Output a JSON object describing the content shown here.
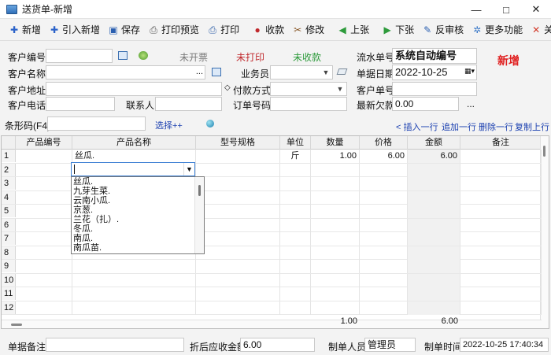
{
  "window": {
    "title": "送货单-新增",
    "minimize": "—",
    "maximize": "□",
    "close": "✕"
  },
  "toolbar": [
    {
      "id": "new",
      "label": "新增",
      "icon": "plus-icon",
      "glyph": "✚",
      "color": "#2c63c9"
    },
    {
      "id": "import-new",
      "label": "引入新增",
      "icon": "plus-icon",
      "glyph": "✚",
      "color": "#2c63c9"
    },
    {
      "id": "save",
      "label": "保存",
      "icon": "save-icon",
      "glyph": "▣",
      "color": "#2a5fb0"
    },
    {
      "id": "print-preview",
      "label": "打印预览",
      "icon": "print-preview-icon",
      "glyph": "⎙",
      "color": "#555"
    },
    {
      "id": "print",
      "label": "打印",
      "icon": "printer-icon",
      "glyph": "⎙",
      "color": "#2f5fa8"
    },
    {
      "id": "collect",
      "label": "收款",
      "icon": "collect-icon",
      "glyph": "●",
      "color": "#c0282c"
    },
    {
      "id": "edit",
      "label": "修改",
      "icon": "edit-icon",
      "glyph": "✂",
      "color": "#8a5a2b"
    },
    {
      "id": "prev",
      "label": "上张",
      "icon": "prev-icon",
      "glyph": "◀",
      "color": "#2e9b3c"
    },
    {
      "id": "next",
      "label": "下张",
      "icon": "next-icon",
      "glyph": "▶",
      "color": "#2e9b3c"
    },
    {
      "id": "unaudit",
      "label": "反审核",
      "icon": "unaudit-icon",
      "glyph": "✎",
      "color": "#2a5fb0"
    },
    {
      "id": "more",
      "label": "更多功能",
      "icon": "gear-icon",
      "glyph": "✲",
      "color": "#3a78c8"
    },
    {
      "id": "close",
      "label": "关闭",
      "icon": "close-icon",
      "glyph": "✕",
      "color": "#d23a2a"
    }
  ],
  "form": {
    "customer_code_label": "客户编号",
    "customer_name_label": "客户名称",
    "customer_address_label": "客户地址",
    "customer_phone_label": "客户电话",
    "contact_label": "联系人",
    "status_invoice": "未开票",
    "status_print": "未打印",
    "status_collect": "未收款",
    "salesman_label": "业务员",
    "payment_label": "付款方式",
    "order_no_label": "订单号码",
    "serial_label": "流水单号",
    "serial_value": "系统自动编号",
    "doc_date_label": "单据日期",
    "doc_date_value": "2022-10-25",
    "customer_doc_label": "客户单号",
    "latest_debt_label": "最新欠款",
    "latest_debt_value": "0.00",
    "mode_badge": "新增",
    "ellipsis": "...",
    "ellipsis2": "...",
    "diamond": "◇"
  },
  "barcode": {
    "label": "条形码(F4)",
    "select_link": "选择++",
    "insert_row": "< 插入一行",
    "append_row": "追加一行",
    "delete_row": "删除一行",
    "copy_prev": "复制上行"
  },
  "grid": {
    "columns": [
      "产品编号",
      "产品名称",
      "型号规格",
      "单位",
      "数量",
      "价格",
      "金额",
      "备注"
    ],
    "rows": [
      {
        "no": "1",
        "code": "",
        "name": "丝瓜.",
        "spec": "",
        "unit": "斤",
        "qty": "1.00",
        "price": "6.00",
        "amount": "6.00",
        "note": ""
      },
      {
        "no": "2"
      },
      {
        "no": "3"
      },
      {
        "no": "4"
      },
      {
        "no": "5"
      },
      {
        "no": "6"
      },
      {
        "no": "7"
      },
      {
        "no": "8"
      },
      {
        "no": "9"
      },
      {
        "no": "10"
      },
      {
        "no": "11"
      },
      {
        "no": "12"
      }
    ],
    "total_qty": "1.00",
    "total_amount": "6.00",
    "dropdown_options": [
      "丝瓜.",
      "九芽生菜.",
      "云南小瓜.",
      "京葱.",
      "兰花（扎）.",
      "冬瓜.",
      "南瓜.",
      "南瓜苗."
    ]
  },
  "footer": {
    "remark_label": "单据备注",
    "discount_label": "折后应收金额",
    "discount_value": "6.00",
    "maker_label": "制单人员",
    "maker_value": "管理员",
    "time_label": "制单时间",
    "time_value": "2022-10-25 17:40:34"
  },
  "colors": {
    "status_red": "#c0282c",
    "status_green": "#2e9b3c",
    "status_gray": "#7a7a7a",
    "link": "#1a3fb0",
    "badge": "#e02020"
  }
}
